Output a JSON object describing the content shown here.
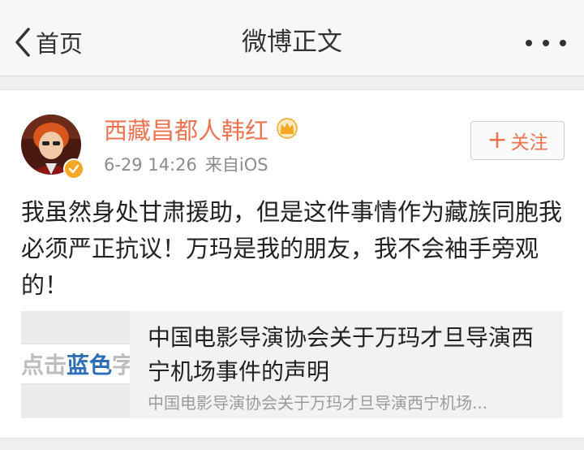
{
  "nav": {
    "back_label": "首页",
    "title": "微博正文"
  },
  "post": {
    "username": "西藏昌都人韩红",
    "timestamp": "6-29 14:26",
    "source": "来自iOS",
    "follow_label": "关注",
    "text": "我虽然身处甘肃援助，但是这件事情作为藏族同胞我必须严正抗议！万玛是我的朋友，我不会袖手旁观的！",
    "link": {
      "thumb_text_gray": "点击",
      "thumb_text_blue": "蓝色",
      "thumb_text_tail": "字",
      "title": "中国电影导演协会关于万玛才旦导演西宁机场事件的声明",
      "description": "中国电影导演协会关于万玛才旦导演西宁机场..."
    }
  },
  "colors": {
    "accent": "#eb7350",
    "verified": "#f5a623",
    "crown": "#f5a623",
    "link_blue": "#2c6fb7"
  },
  "icons": [
    "chevron-left-icon",
    "more-icon",
    "verified-icon",
    "crown-icon",
    "plus-icon"
  ]
}
